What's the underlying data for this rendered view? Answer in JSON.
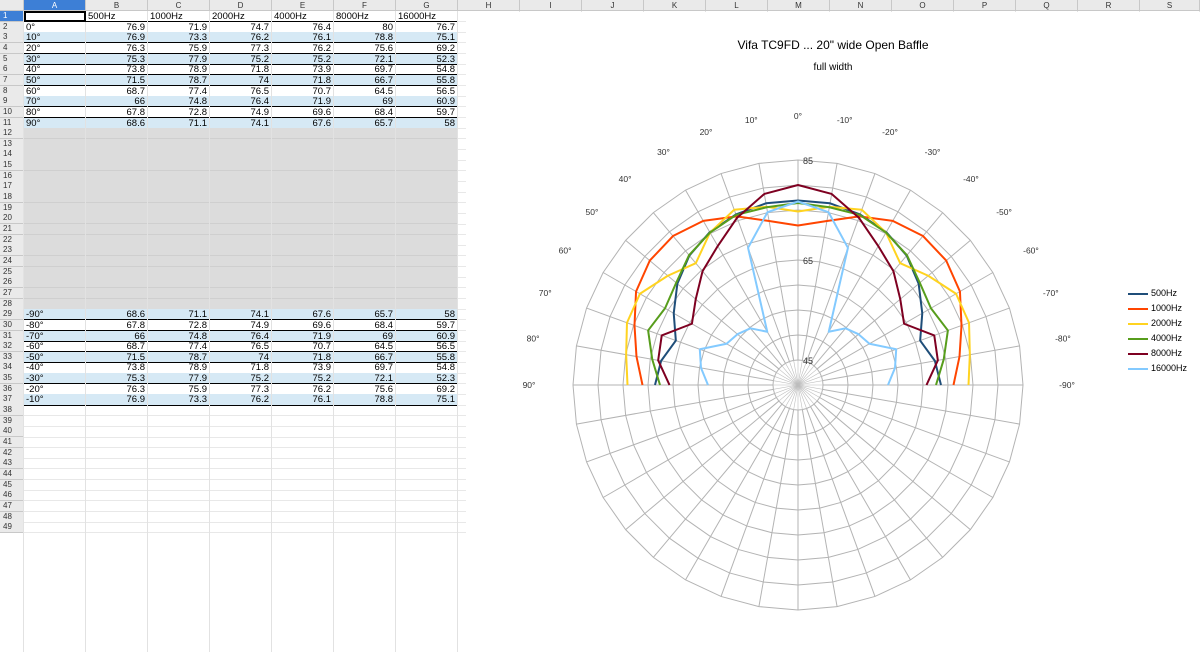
{
  "spreadsheet": {
    "column_headers": [
      "A",
      "B",
      "C",
      "D",
      "E",
      "F",
      "G",
      "H",
      "I",
      "J",
      "K",
      "L",
      "M",
      "N",
      "O",
      "P",
      "Q",
      "R",
      "S"
    ],
    "selected_column": "A",
    "selected_row": "1",
    "header_row": [
      "",
      "500Hz",
      "1000Hz",
      "2000Hz",
      "4000Hz",
      "8000Hz",
      "16000Hz"
    ],
    "rows_top": [
      {
        "row": "2",
        "label": "0°",
        "values": [
          "76.9",
          "71.9",
          "74.7",
          "76.4",
          "80",
          "76.7"
        ]
      },
      {
        "row": "3",
        "label": "10°",
        "values": [
          "76.9",
          "73.3",
          "76.2",
          "76.1",
          "78.8",
          "75.1"
        ]
      },
      {
        "row": "4",
        "label": "20°",
        "values": [
          "76.3",
          "75.9",
          "77.3",
          "76.2",
          "75.6",
          "69.2"
        ]
      },
      {
        "row": "5",
        "label": "30°",
        "values": [
          "75.3",
          "77.9",
          "75.2",
          "75.2",
          "72.1",
          "52.3"
        ]
      },
      {
        "row": "6",
        "label": "40°",
        "values": [
          "73.8",
          "78.9",
          "71.8",
          "73.9",
          "69.7",
          "54.8"
        ]
      },
      {
        "row": "7",
        "label": "50°",
        "values": [
          "71.5",
          "78.7",
          "74",
          "71.8",
          "66.7",
          "55.8"
        ]
      },
      {
        "row": "8",
        "label": "60°",
        "values": [
          "68.7",
          "77.4",
          "76.5",
          "70.7",
          "64.5",
          "56.5"
        ]
      },
      {
        "row": "9",
        "label": "70°",
        "values": [
          "66",
          "74.8",
          "76.4",
          "71.9",
          "69",
          "60.9"
        ]
      },
      {
        "row": "10",
        "label": "80°",
        "values": [
          "67.8",
          "72.8",
          "74.9",
          "69.6",
          "68.4",
          "59.7"
        ]
      },
      {
        "row": "11",
        "label": "90°",
        "values": [
          "68.6",
          "71.1",
          "74.1",
          "67.6",
          "65.7",
          "58"
        ]
      }
    ],
    "gray_rows": [
      "12",
      "13",
      "14",
      "15",
      "16",
      "17",
      "18",
      "19",
      "20",
      "21",
      "22",
      "23",
      "24",
      "25",
      "26",
      "27",
      "28"
    ],
    "rows_bottom": [
      {
        "row": "29",
        "label": "-90°",
        "values": [
          "68.6",
          "71.1",
          "74.1",
          "67.6",
          "65.7",
          "58"
        ]
      },
      {
        "row": "30",
        "label": "-80°",
        "values": [
          "67.8",
          "72.8",
          "74.9",
          "69.6",
          "68.4",
          "59.7"
        ]
      },
      {
        "row": "31",
        "label": "-70°",
        "values": [
          "66",
          "74.8",
          "76.4",
          "71.9",
          "69",
          "60.9"
        ]
      },
      {
        "row": "32",
        "label": "-60°",
        "values": [
          "68.7",
          "77.4",
          "76.5",
          "70.7",
          "64.5",
          "56.5"
        ]
      },
      {
        "row": "33",
        "label": "-50°",
        "values": [
          "71.5",
          "78.7",
          "74",
          "71.8",
          "66.7",
          "55.8"
        ]
      },
      {
        "row": "34",
        "label": "-40°",
        "values": [
          "73.8",
          "78.9",
          "71.8",
          "73.9",
          "69.7",
          "54.8"
        ]
      },
      {
        "row": "35",
        "label": "-30°",
        "values": [
          "75.3",
          "77.9",
          "75.2",
          "75.2",
          "72.1",
          "52.3"
        ]
      },
      {
        "row": "36",
        "label": "-20°",
        "values": [
          "76.3",
          "75.9",
          "77.3",
          "76.2",
          "75.6",
          "69.2"
        ]
      },
      {
        "row": "37",
        "label": "-10°",
        "values": [
          "76.9",
          "73.3",
          "76.2",
          "76.1",
          "78.8",
          "75.1"
        ]
      }
    ],
    "empty_rows": [
      "38",
      "39",
      "40",
      "41",
      "42",
      "43",
      "44",
      "45",
      "46",
      "47",
      "48",
      "49"
    ]
  },
  "chart_data": {
    "type": "polar",
    "title": "Vifa TC9FD ... 20\" wide Open Baffle",
    "subtitle": "full width",
    "radial_range": [
      45,
      85
    ],
    "radial_tick_labels": [
      "85",
      "65",
      "45"
    ],
    "angle_labels": [
      "0°",
      "10°",
      "20°",
      "30°",
      "40°",
      "50°",
      "60°",
      "70°",
      "80°",
      "90°",
      "-10°",
      "-20°",
      "-30°",
      "-40°",
      "-50°",
      "-60°",
      "-70°",
      "-80°",
      "-90°"
    ],
    "angles": [
      -90,
      -80,
      -70,
      -60,
      -50,
      -40,
      -30,
      -20,
      -10,
      0,
      10,
      20,
      30,
      40,
      50,
      60,
      70,
      80,
      90
    ],
    "grid": true,
    "legend_position": "right",
    "series": [
      {
        "name": "500Hz",
        "color": "#1f4e79",
        "values": [
          68.6,
          67.8,
          66,
          68.7,
          71.5,
          73.8,
          75.3,
          76.3,
          76.9,
          76.9,
          76.9,
          76.3,
          75.3,
          73.8,
          71.5,
          68.7,
          66,
          67.8,
          68.6
        ]
      },
      {
        "name": "1000Hz",
        "color": "#ff4500",
        "values": [
          71.1,
          72.8,
          74.8,
          77.4,
          78.7,
          78.9,
          77.9,
          75.9,
          73.3,
          71.9,
          73.3,
          75.9,
          77.9,
          78.9,
          78.7,
          77.4,
          74.8,
          72.8,
          71.1
        ]
      },
      {
        "name": "2000Hz",
        "color": "#ffd320",
        "values": [
          74.1,
          74.9,
          76.4,
          76.5,
          74,
          71.8,
          75.2,
          77.3,
          76.2,
          74.7,
          76.2,
          77.3,
          75.2,
          71.8,
          74,
          76.5,
          76.4,
          74.9,
          74.1
        ]
      },
      {
        "name": "4000Hz",
        "color": "#579d1c",
        "values": [
          67.6,
          69.6,
          71.9,
          70.7,
          71.8,
          73.9,
          75.2,
          76.2,
          76.1,
          76.4,
          76.1,
          76.2,
          75.2,
          73.9,
          71.8,
          70.7,
          71.9,
          69.6,
          67.6
        ]
      },
      {
        "name": "8000Hz",
        "color": "#7e0021",
        "values": [
          65.7,
          68.4,
          69,
          64.5,
          66.7,
          69.7,
          72.1,
          75.6,
          78.8,
          80,
          78.8,
          75.6,
          72.1,
          69.7,
          66.7,
          64.5,
          69,
          68.4,
          65.7
        ]
      },
      {
        "name": "16000Hz",
        "color": "#83caff",
        "values": [
          58,
          59.7,
          60.9,
          56.5,
          55.8,
          54.8,
          52.3,
          69.2,
          75.1,
          76.7,
          75.1,
          69.2,
          52.3,
          54.8,
          55.8,
          56.5,
          60.9,
          59.7,
          58
        ]
      }
    ]
  }
}
